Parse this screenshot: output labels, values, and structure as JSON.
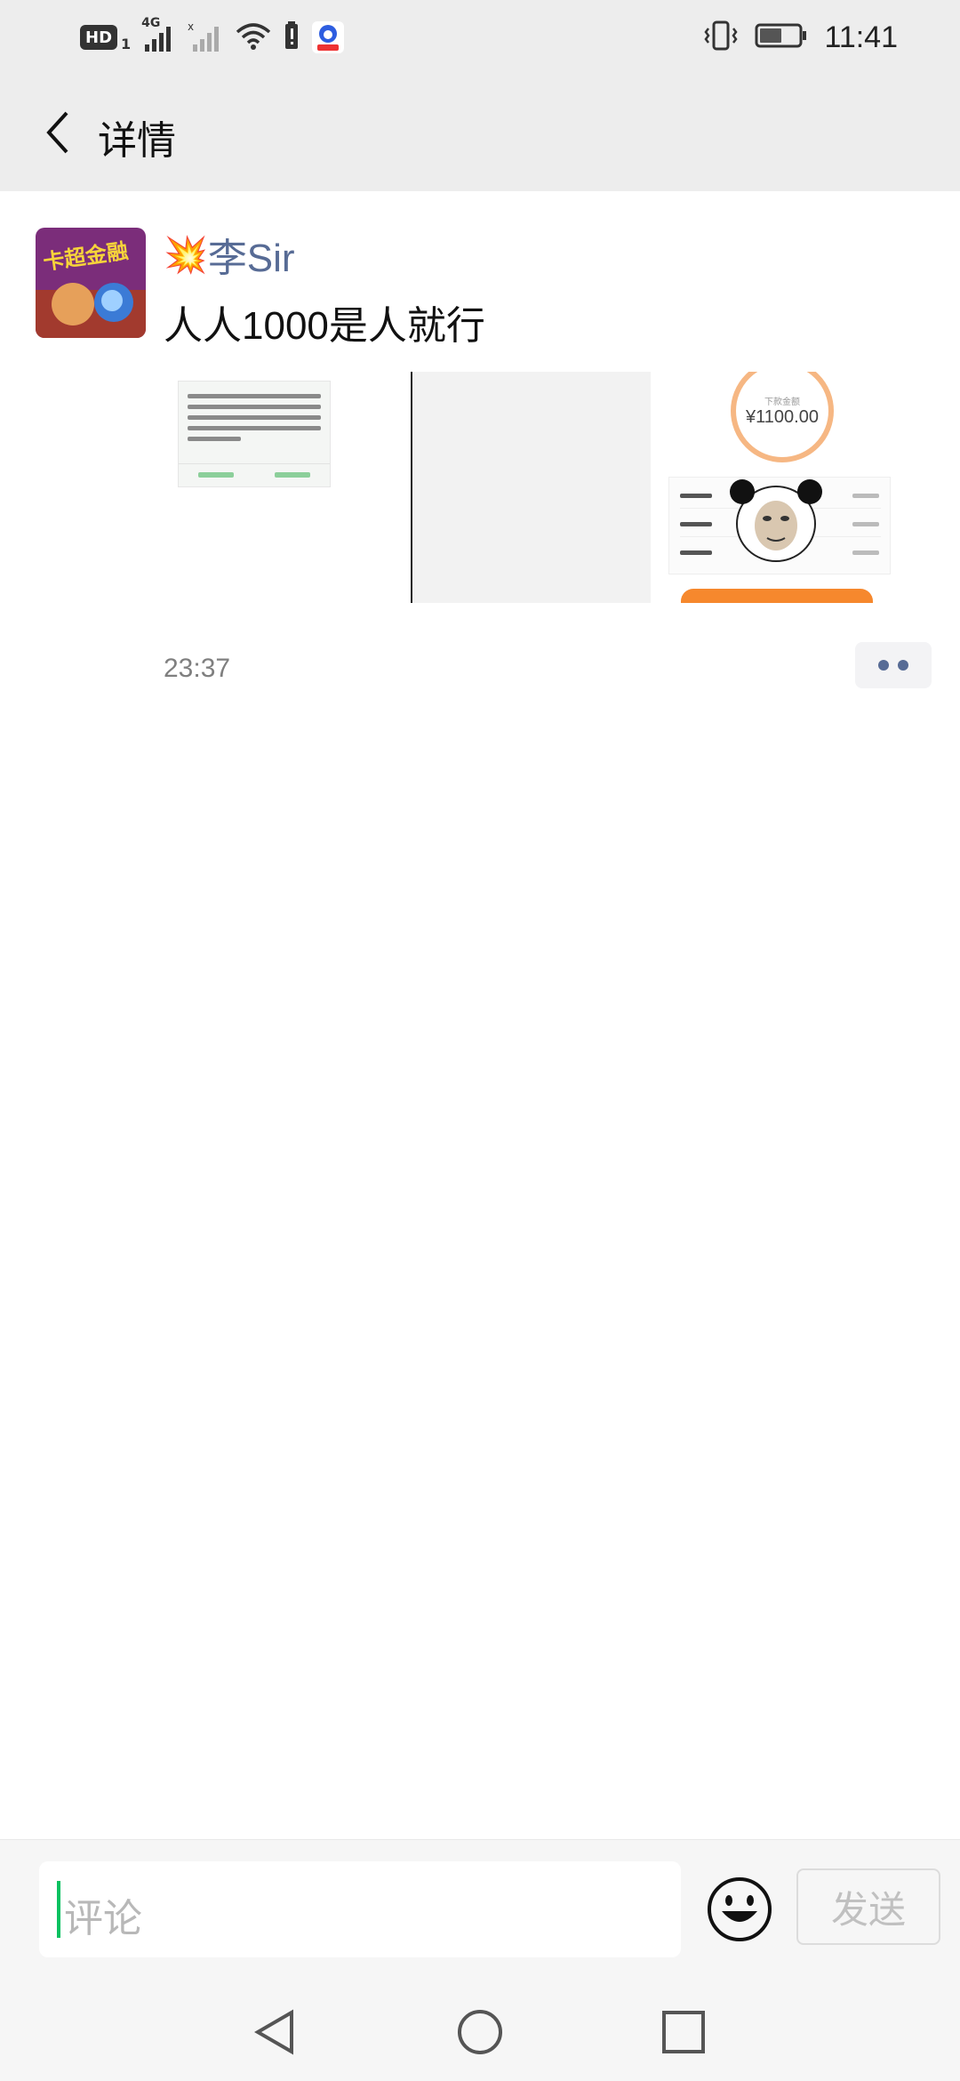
{
  "status_bar": {
    "hd_label": "HD",
    "sim_number": "1",
    "network_label": "4G",
    "time": "11:41",
    "battery_level": 0.55
  },
  "header": {
    "title": "详情"
  },
  "post": {
    "author_emoji": "💥",
    "author_name": "李Sir",
    "text": "人人1000是人就行",
    "timestamp": "23:37",
    "images": {
      "sms_text": "",
      "loan_amount": "¥1100.00",
      "loan_label": "下款金额"
    }
  },
  "comment_bar": {
    "placeholder": "评论",
    "send_label": "发送"
  },
  "colors": {
    "accent_green": "#07c160",
    "link_blue": "#576b95",
    "header_bg": "#ededed"
  }
}
